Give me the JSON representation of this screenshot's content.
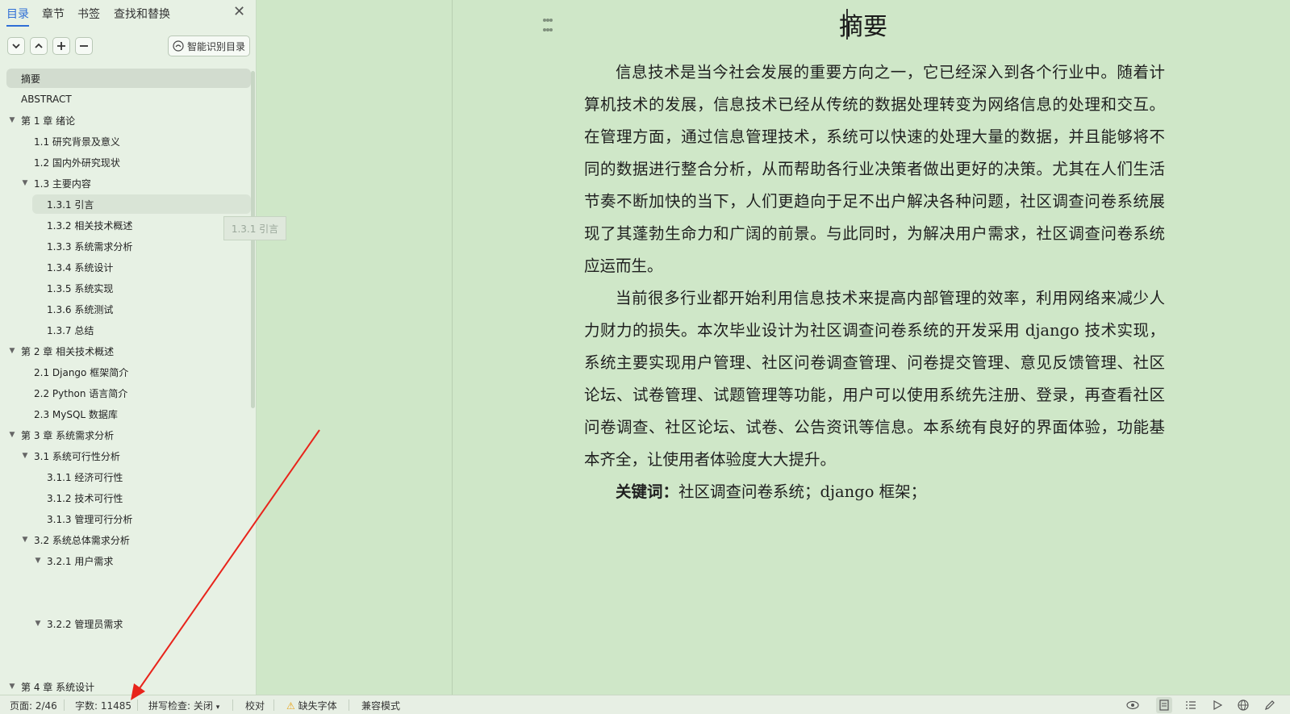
{
  "panel": {
    "tabs": [
      "目录",
      "章节",
      "书签",
      "查找和替换"
    ],
    "close_icon": "close-icon",
    "smart_button": "智能识别目录",
    "tooltip": "1.3.1 引言",
    "toc": [
      {
        "label": "摘要",
        "level": 0,
        "arrow": false
      },
      {
        "label": "ABSTRACT",
        "level": 0,
        "arrow": false
      },
      {
        "label": "第 1 章  绪论",
        "level": 0,
        "arrow": true
      },
      {
        "label": "1.1  研究背景及意义",
        "level": 1,
        "arrow": false
      },
      {
        "label": "1.2  国内外研究现状",
        "level": 1,
        "arrow": false
      },
      {
        "label": "1.3  主要内容",
        "level": 1,
        "arrow": true
      },
      {
        "label": "1.3.1  引言",
        "level": 2,
        "arrow": false
      },
      {
        "label": "1.3.2  相关技术概述",
        "level": 2,
        "arrow": false
      },
      {
        "label": "1.3.3  系统需求分析",
        "level": 2,
        "arrow": false
      },
      {
        "label": "1.3.4  系统设计",
        "level": 2,
        "arrow": false
      },
      {
        "label": "1.3.5  系统实现",
        "level": 2,
        "arrow": false
      },
      {
        "label": "1.3.6  系统测试",
        "level": 2,
        "arrow": false
      },
      {
        "label": "1.3.7  总结",
        "level": 2,
        "arrow": false
      },
      {
        "label": "第 2 章  相关技术概述",
        "level": 0,
        "arrow": true
      },
      {
        "label": "2.1 Django 框架简介",
        "level": 1,
        "arrow": false
      },
      {
        "label": "2.2 Python 语言简介",
        "level": 1,
        "arrow": false
      },
      {
        "label": "2.3 MySQL 数据库",
        "level": 1,
        "arrow": false
      },
      {
        "label": "第 3 章  系统需求分析",
        "level": 0,
        "arrow": true
      },
      {
        "label": "3.1  系统可行性分析",
        "level": 1,
        "arrow": true
      },
      {
        "label": "3.1.1  经济可行性",
        "level": 2,
        "arrow": false
      },
      {
        "label": "3.1.2  技术可行性",
        "level": 2,
        "arrow": false
      },
      {
        "label": "3.1.3  管理可行分析",
        "level": 2,
        "arrow": false
      },
      {
        "label": "3.2  系统总体需求分析",
        "level": 1,
        "arrow": true
      },
      {
        "label": "3.2.1  用户需求",
        "level": 2,
        "arrow": true
      },
      {
        "label": "3.2.2  管理员需求",
        "level": 2,
        "arrow": true
      },
      {
        "label": "第 4 章  系统设计",
        "level": 0,
        "arrow": true
      }
    ]
  },
  "document": {
    "title": "摘要",
    "paragraphs": [
      "信息技术是当今社会发展的重要方向之一，它已经深入到各个行业中。随着计算机技术的发展，信息技术已经从传统的数据处理转变为网络信息的处理和交互。在管理方面，通过信息管理技术，系统可以快速的处理大量的数据，并且能够将不同的数据进行整合分析，从而帮助各行业决策者做出更好的决策。尤其在人们生活节奏不断加快的当下，人们更趋向于足不出户解决各种问题，社区调查问卷系统展现了其蓬勃生命力和广阔的前景。与此同时，为解决用户需求，社区调查问卷系统应运而生。",
      "当前很多行业都开始利用信息技术来提高内部管理的效率，利用网络来减少人力财力的损失。本次毕业设计为社区调查问卷系统的开发采用 django 技术实现，系统主要实现用户管理、社区问卷调查管理、问卷提交管理、意见反馈管理、社区论坛、试卷管理、试题管理等功能，用户可以使用系统先注册、登录，再查看社区问卷调查、社区论坛、试卷、公告资讯等信息。本系统有良好的界面体验，功能基本齐全，让使用者体验度大大提升。"
    ],
    "keywords_label": "关键词：",
    "keywords_value": "社区调查问卷系统；django 框架；"
  },
  "status": {
    "page": "页面: 2/46",
    "words": "字数: 11485",
    "spell": "拼写检查: 关闭",
    "proof": "校对",
    "missing_font": "缺失字体",
    "compat": "兼容模式"
  },
  "colors": {
    "accent": "#2f6fd6",
    "annotation_arrow": "#e8241b",
    "doc_background": "#cfe7c8"
  }
}
